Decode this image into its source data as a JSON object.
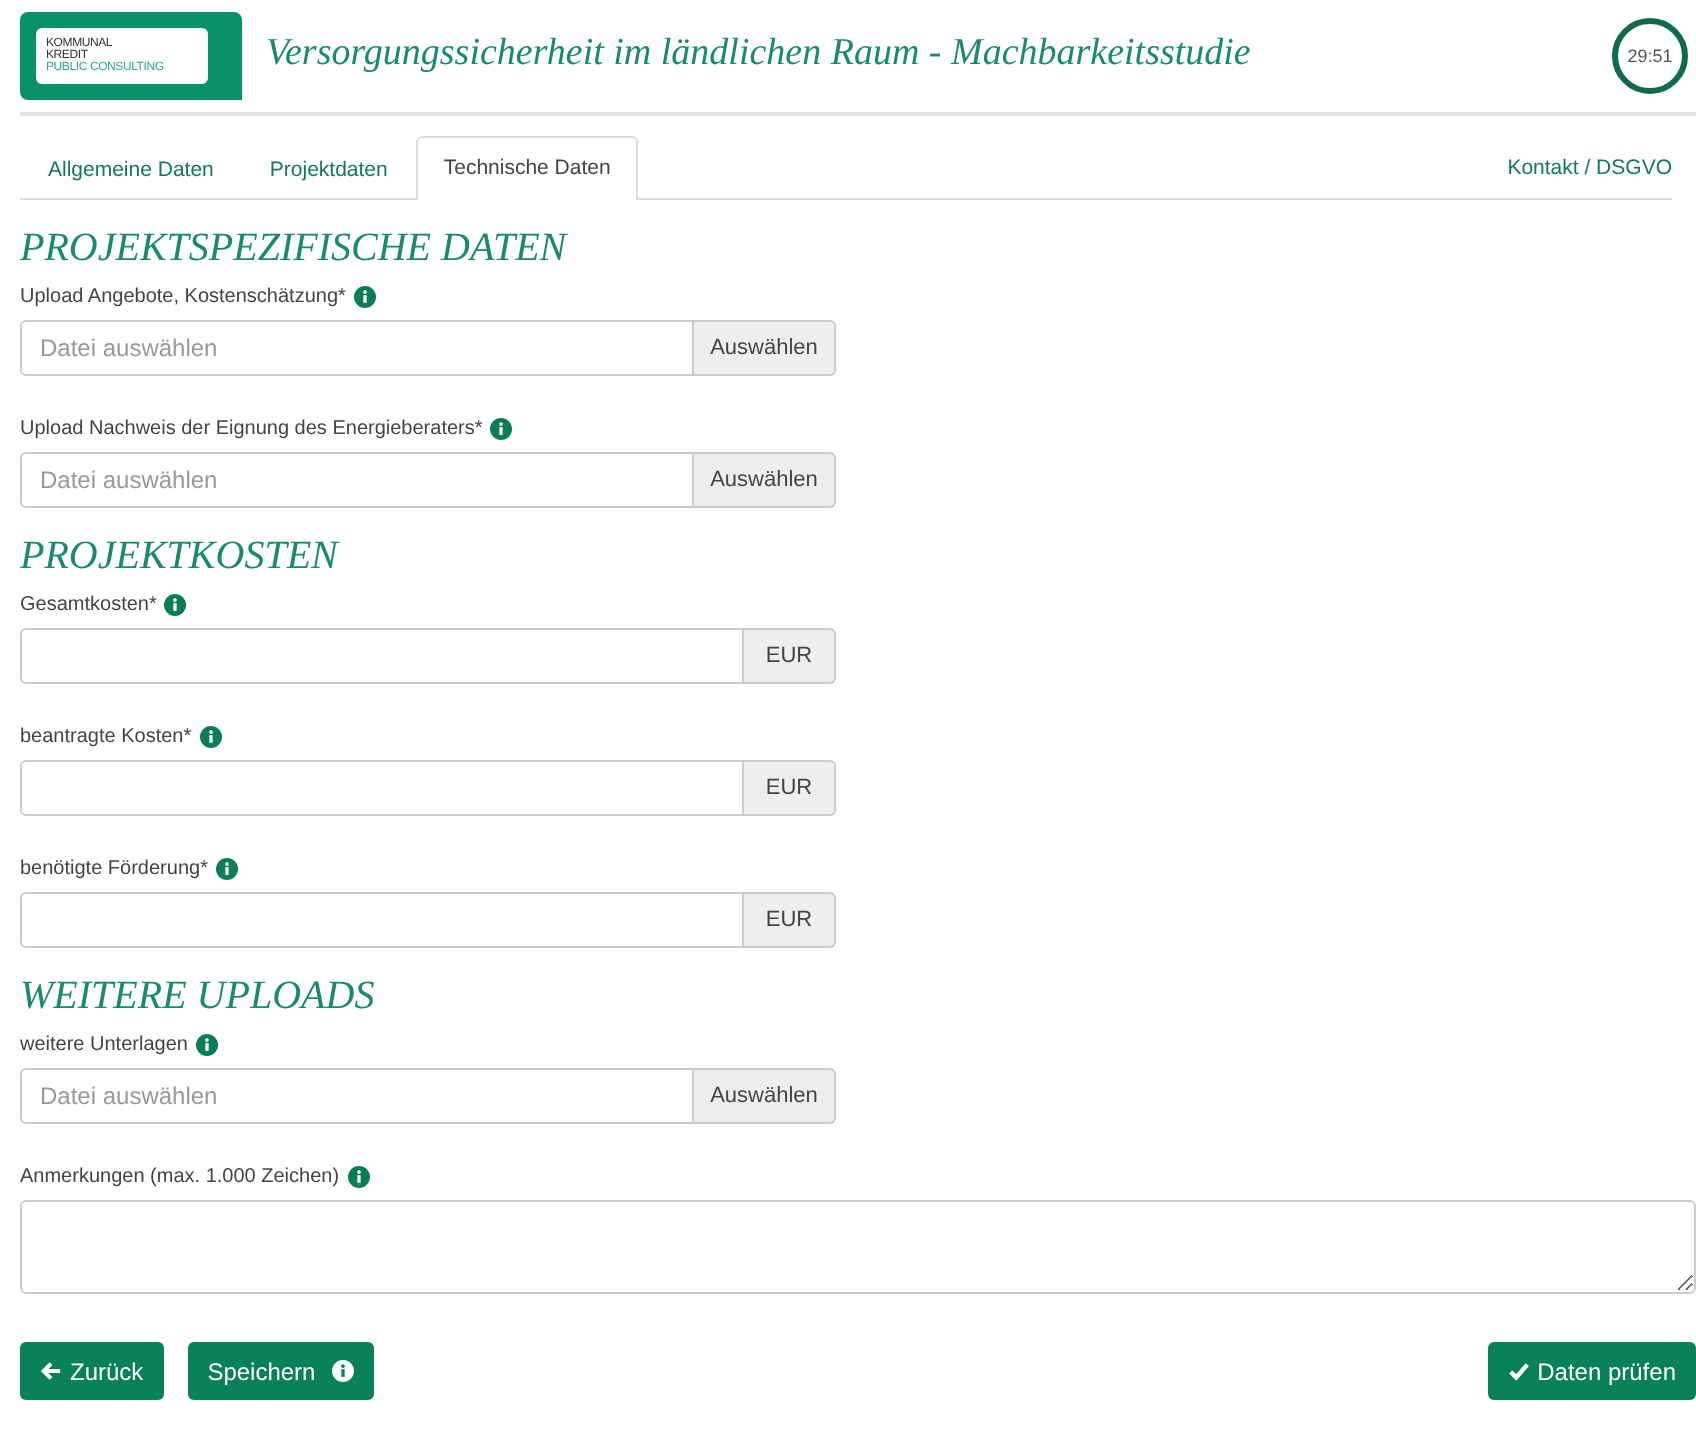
{
  "logo": {
    "lines": [
      "KOMMUNAL",
      "KREDIT",
      "PUBLIC CONSULTING"
    ]
  },
  "title": "Versorgungssicherheit im ländlichen Raum - Machbarkeitsstudie",
  "timer": "29:51",
  "tabs": [
    {
      "label": "Allgemeine Daten",
      "selected": false
    },
    {
      "label": "Projektdaten",
      "selected": false
    },
    {
      "label": "Technische Daten",
      "selected": true
    }
  ],
  "contact_link": "Kontakt / DSGVO",
  "sections": [
    {
      "heading": "PROJEKTSPEZIFISCHE DATEN",
      "fields": [
        {
          "kind": "file",
          "label": "Upload Angebote, Kostenschätzung*",
          "info": true,
          "placeholder": "Datei auswählen",
          "button": "Auswählen"
        },
        {
          "kind": "file",
          "label": "Upload Nachweis der Eignung des Energieberaters*",
          "info": true,
          "placeholder": "Datei auswählen",
          "button": "Auswählen"
        }
      ]
    },
    {
      "heading": "PROJEKTKOSTEN",
      "fields": [
        {
          "kind": "currency",
          "label": "Gesamtkosten*",
          "info": true,
          "addon": "EUR"
        },
        {
          "kind": "currency",
          "label": "beantragte Kosten*",
          "info": true,
          "addon": "EUR"
        },
        {
          "kind": "currency",
          "label": "benötigte Förderung*",
          "info": true,
          "addon": "EUR"
        }
      ]
    },
    {
      "heading": "WEITERE UPLOADS",
      "fields": [
        {
          "kind": "file",
          "label": "weitere Unterlagen",
          "info": true,
          "placeholder": "Datei auswählen",
          "button": "Auswählen"
        },
        {
          "kind": "textarea",
          "label": "Anmerkungen (max. 1.000 Zeichen)",
          "info": true
        }
      ]
    }
  ],
  "buttons": [
    {
      "kind": "back",
      "label": "Zurück"
    },
    {
      "kind": "save",
      "label": "Speichern"
    },
    {
      "kind": "check",
      "label": "Daten prüfen"
    }
  ]
}
